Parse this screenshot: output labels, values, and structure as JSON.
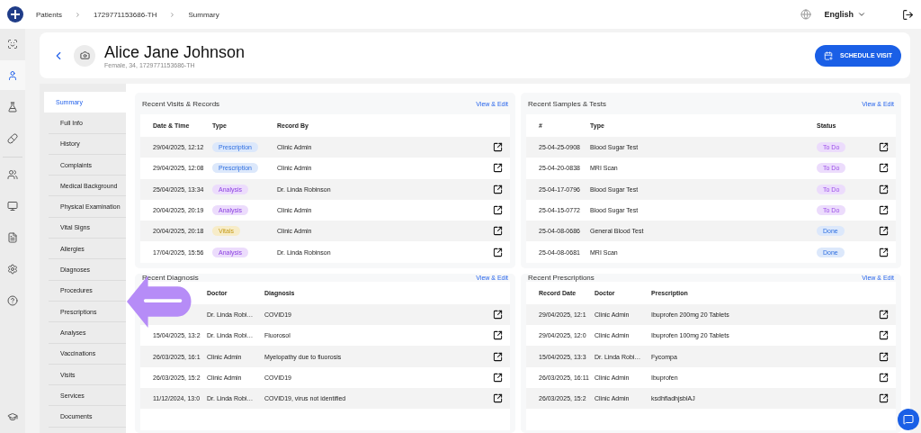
{
  "breadcrumbs": [
    "Patients",
    "1729771153686-TH",
    "Summary"
  ],
  "language": "English",
  "rail": [
    {
      "kind": "overview",
      "selected": false
    },
    {
      "kind": "patients",
      "selected": true
    },
    {
      "kind": "lab",
      "selected": false
    },
    {
      "kind": "pharmacy",
      "selected": false
    },
    {
      "kind": "team",
      "selected": false
    },
    {
      "kind": "screen",
      "selected": false
    },
    {
      "kind": "reports",
      "selected": false
    },
    {
      "kind": "settings",
      "selected": false
    },
    {
      "kind": "help",
      "selected": false
    },
    {
      "kind": "learning",
      "selected": false
    }
  ],
  "patient": {
    "name": "Alice Jane Johnson",
    "details": "Female, 34, 1729771153686-TH"
  },
  "schedule_button": "SCHEDULE VISIT",
  "nav": [
    {
      "label": "Summary",
      "selected": true
    },
    {
      "label": "Full Info",
      "selected": false
    },
    {
      "label": "History",
      "selected": false
    },
    {
      "label": "Complaints",
      "selected": false
    },
    {
      "label": "Medical Background",
      "selected": false
    },
    {
      "label": "Physical Examination",
      "selected": false
    },
    {
      "label": "Vital Signs",
      "selected": false
    },
    {
      "label": "Allergies",
      "selected": false
    },
    {
      "label": "Diagnoses",
      "selected": false
    },
    {
      "label": "Procedures",
      "selected": false
    },
    {
      "label": "Prescriptions",
      "selected": false
    },
    {
      "label": "Analyses",
      "selected": false
    },
    {
      "label": "Vaccinations",
      "selected": false
    },
    {
      "label": "Visits",
      "selected": false
    },
    {
      "label": "Services",
      "selected": false
    },
    {
      "label": "Documents",
      "selected": false
    }
  ],
  "cards": [
    {
      "kind": "visits",
      "title": "Recent Visits & Records",
      "action": "View & Edit",
      "columns": [
        "Date & Time",
        "Type",
        "Record By"
      ],
      "rows": [
        {
          "cells": [
            "29/04/2025, 12:12",
            {
              "label": "Prescription",
              "kind": "prescription"
            },
            "Clinic Admin"
          ]
        },
        {
          "cells": [
            "29/04/2025, 12:08",
            {
              "label": "Prescription",
              "kind": "prescription"
            },
            "Clinic Admin"
          ]
        },
        {
          "cells": [
            "25/04/2025, 13:34",
            {
              "label": "Analysis",
              "kind": "analysis"
            },
            "Dr. Linda Robinson"
          ]
        },
        {
          "cells": [
            "20/04/2025, 20:19",
            {
              "label": "Analysis",
              "kind": "analysis"
            },
            "Clinic Admin"
          ]
        },
        {
          "cells": [
            "20/04/2025, 20:18",
            {
              "label": "Vitals",
              "kind": "vitals"
            },
            "Clinic Admin"
          ]
        },
        {
          "cells": [
            "17/04/2025, 15:56",
            {
              "label": "Analysis",
              "kind": "analysis"
            },
            "Dr. Linda Robinson"
          ]
        }
      ]
    },
    {
      "kind": "samples",
      "title": "Recent Samples & Tests",
      "action": "View & Edit",
      "columns": [
        "#",
        "Type",
        "Status"
      ],
      "rows": [
        {
          "cells": [
            "25-04-25-0908",
            "Blood Sugar Test",
            {
              "label": "To Do",
              "kind": "todo"
            }
          ]
        },
        {
          "cells": [
            "25-04-20-0838",
            "MRI Scan",
            {
              "label": "To Do",
              "kind": "todo"
            }
          ]
        },
        {
          "cells": [
            "25-04-17-0796",
            "Blood Sugar Test",
            {
              "label": "To Do",
              "kind": "todo"
            }
          ]
        },
        {
          "cells": [
            "25-04-15-0772",
            "Blood Sugar Test",
            {
              "label": "To Do",
              "kind": "todo"
            }
          ]
        },
        {
          "cells": [
            "25-04-08-0686",
            "General Blood Test",
            {
              "label": "Done",
              "kind": "done"
            }
          ]
        },
        {
          "cells": [
            "25-04-08-0681",
            "MRI Scan",
            {
              "label": "Done",
              "kind": "done"
            }
          ]
        }
      ]
    },
    {
      "kind": "diagnosis",
      "title": "Recent Diagnosis",
      "action": "View & Edit",
      "columns": [
        "Doctor",
        "Diagnosis"
      ],
      "rows": [
        {
          "cells": [
            "Dr. Linda Robi…",
            "COVID19"
          ]
        },
        {
          "cells": [
            "15/04/2025, 13:2",
            "Dr. Linda Robi…",
            "Fluorosol"
          ]
        },
        {
          "cells": [
            "26/03/2025, 16:1",
            "Clinic Admin",
            "Myelopathy due to fluorosis"
          ]
        },
        {
          "cells": [
            "26/03/2025, 15:2",
            "Clinic Admin",
            "COVID19"
          ]
        },
        {
          "cells": [
            "11/12/2024, 13:0",
            "Dr. Linda Robi…",
            "COVID19, virus not identified"
          ]
        }
      ]
    },
    {
      "kind": "prescriptions",
      "title": "Recent Prescriptions",
      "action": "View & Edit",
      "columns": [
        "Record Date",
        "Doctor",
        "Prescription"
      ],
      "rows": [
        {
          "cells": [
            "29/04/2025, 12:1",
            "Clinic Admin",
            "Ibuprofen 200mg 20 Tablets"
          ]
        },
        {
          "cells": [
            "29/04/2025, 12:0",
            "Clinic Admin",
            "Ibuprofen 100mg 20 Tablets"
          ]
        },
        {
          "cells": [
            "15/04/2025, 13:3",
            "Dr. Linda Robi…",
            "Fycompa"
          ]
        },
        {
          "cells": [
            "26/03/2025, 16:11",
            "Clinic Admin",
            "Ibuprofen"
          ]
        },
        {
          "cells": [
            "26/03/2025, 15:2",
            "Clinic Admin",
            "ksdhfladhjsblAJ"
          ]
        }
      ]
    }
  ]
}
